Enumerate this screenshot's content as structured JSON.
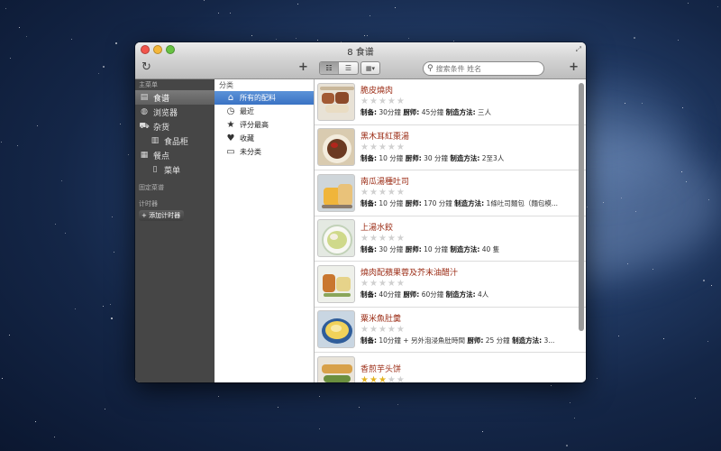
{
  "window": {
    "title": "8 食谱"
  },
  "search": {
    "placeholder": "搜索条件 姓名"
  },
  "sidebar": {
    "main_header": "主菜单",
    "items": [
      {
        "label": "食谱",
        "icon": "recipe-box-icon",
        "selected": true
      },
      {
        "label": "浏览器",
        "icon": "globe-icon"
      },
      {
        "label": "杂货",
        "icon": "cart-icon"
      },
      {
        "label": "食品柜",
        "icon": "pantry-icon",
        "sub": true
      },
      {
        "label": "餐点",
        "icon": "calendar-icon"
      },
      {
        "label": "菜单",
        "icon": "menu-card-icon",
        "sub": true
      }
    ],
    "pinned_header": "固定菜谱",
    "timer_header": "计时器",
    "add_timer": "+ 添加计时器"
  },
  "categories": {
    "header": "分类",
    "items": [
      {
        "label": "所有的配料",
        "icon": "home-icon",
        "selected": true
      },
      {
        "label": "最近",
        "icon": "clock-icon"
      },
      {
        "label": "评分最高",
        "icon": "star-icon"
      },
      {
        "label": "收藏",
        "icon": "heart-icon"
      },
      {
        "label": "未分类",
        "icon": "box-icon"
      }
    ]
  },
  "recipes": [
    {
      "title": "脆皮燒肉",
      "rating": 0,
      "meta_label_prep": "制备:",
      "prep": " 30分鐘 ",
      "meta_label_chef": "厨师:",
      "chef": " 45分鐘 ",
      "meta_label_method": "制造方法:",
      "method": " 三人"
    },
    {
      "title": "黑木耳紅棗湯",
      "rating": 0,
      "meta_label_prep": "制备:",
      "prep": " 10 分鐘 ",
      "meta_label_chef": "厨师:",
      "chef": " 30 分鐘 ",
      "meta_label_method": "制造方法:",
      "method": " 2至3人"
    },
    {
      "title": "南瓜湯種吐司",
      "rating": 0,
      "meta_label_prep": "制备:",
      "prep": " 10 分鐘 ",
      "meta_label_chef": "厨师:",
      "chef": " 170 分鐘 ",
      "meta_label_method": "制造方法:",
      "method": " 1條吐司麵包（麵包模..."
    },
    {
      "title": "上湯水餃",
      "rating": 0,
      "meta_label_prep": "制备:",
      "prep": " 30 分鐘 ",
      "meta_label_chef": "厨师:",
      "chef": " 10 分鐘 ",
      "meta_label_method": "制造方法:",
      "method": " 40 隻"
    },
    {
      "title": "燒肉配蘋果蓉及芥末油醋汁",
      "rating": 0,
      "meta_label_prep": "制备:",
      "prep": " 40分鐘 ",
      "meta_label_chef": "厨师:",
      "chef": " 60分鐘 ",
      "meta_label_method": "制造方法:",
      "method": " 4人"
    },
    {
      "title": "粟米魚肚羹",
      "rating": 0,
      "meta_label_prep": "制备:",
      "prep": " 10分鐘 + 另外泡浸魚肚時間 ",
      "meta_label_chef": "厨师:",
      "chef": " 25 分鐘 ",
      "meta_label_method": "制造方法:",
      "method": " 3..."
    },
    {
      "title": "香煎芋头饼",
      "rating": 3,
      "meta_label_prep": "",
      "prep": "",
      "meta_label_chef": "",
      "chef": "",
      "meta_label_method": "",
      "method": ""
    }
  ],
  "colors": {
    "recipe_title": "#9b2b14",
    "selection": "#3a73c4",
    "star_on": "#e3b320",
    "sidebar_bg": "#464646"
  }
}
